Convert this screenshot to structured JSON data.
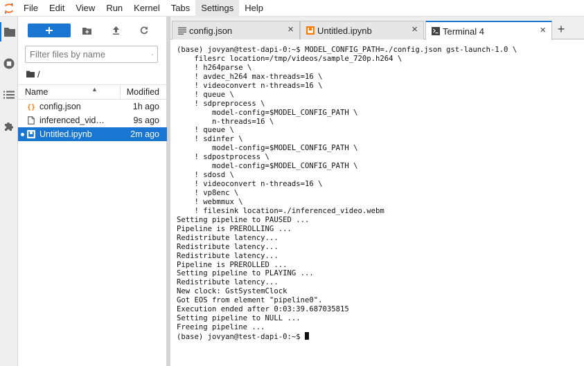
{
  "menubar": {
    "logo_icon": "jupyter-logo-icon",
    "items": [
      "File",
      "Edit",
      "View",
      "Run",
      "Kernel",
      "Tabs",
      "Settings",
      "Help"
    ],
    "active_index": 6
  },
  "sidebar": {
    "icons": [
      "folder-icon",
      "running-icon",
      "list-icon",
      "extension-icon"
    ],
    "active_index": 0
  },
  "filebrowser": {
    "new_icon": "plus-icon",
    "toolbar_icons": [
      "new-folder-icon",
      "upload-icon",
      "refresh-icon"
    ],
    "search_placeholder": "Filter files by name",
    "search_value": "",
    "breadcrumb": "/",
    "columns": {
      "name": "Name",
      "modified": "Modified"
    },
    "files": [
      {
        "name": "config.json",
        "modified": "1h ago",
        "icon": "json-icon",
        "selected": false,
        "running": false
      },
      {
        "name": "inferenced_vide...",
        "modified": "9s ago",
        "icon": "file-icon",
        "selected": false,
        "running": false
      },
      {
        "name": "Untitled.ipynb",
        "modified": "2m ago",
        "icon": "notebook-icon",
        "selected": true,
        "running": true
      }
    ]
  },
  "tabs": [
    {
      "label": "config.json",
      "icon": "text-file-icon",
      "current": false
    },
    {
      "label": "Untitled.ipynb",
      "icon": "notebook-icon",
      "current": false
    },
    {
      "label": "Terminal 4",
      "icon": "terminal-icon",
      "current": true
    }
  ],
  "colors": {
    "accent": "#1976d2",
    "notebook_orange": "#f57c00",
    "json_orange": "#f57c00"
  },
  "terminal": {
    "lines": [
      "(base) jovyan@test-dapi-0:~$ MODEL_CONFIG_PATH=./config.json gst-launch-1.0 \\",
      "    filesrc location=/tmp/videos/sample_720p.h264 \\",
      "    ! h264parse \\",
      "    ! avdec_h264 max-threads=16 \\",
      "    ! videoconvert n-threads=16 \\",
      "    ! queue \\",
      "    ! sdpreprocess \\",
      "        model-config=$MODEL_CONFIG_PATH \\",
      "        n-threads=16 \\",
      "    ! queue \\",
      "    ! sdinfer \\",
      "        model-config=$MODEL_CONFIG_PATH \\",
      "    ! sdpostprocess \\",
      "        model-config=$MODEL_CONFIG_PATH \\",
      "    ! sdosd \\",
      "    ! videoconvert n-threads=16 \\",
      "    ! vp8enc \\",
      "    ! webmmux \\",
      "    ! filesink location=./inferenced_video.webm",
      "Setting pipeline to PAUSED ...",
      "Pipeline is PREROLLING ...",
      "Redistribute latency...",
      "Redistribute latency...",
      "Redistribute latency...",
      "Pipeline is PREROLLED ...",
      "Setting pipeline to PLAYING ...",
      "Redistribute latency...",
      "New clock: GstSystemClock",
      "Got EOS from element \"pipeline0\".",
      "Execution ended after 0:03:39.687035815",
      "Setting pipeline to NULL ...",
      "Freeing pipeline ..."
    ],
    "prompt": "(base) jovyan@test-dapi-0:~$ "
  }
}
